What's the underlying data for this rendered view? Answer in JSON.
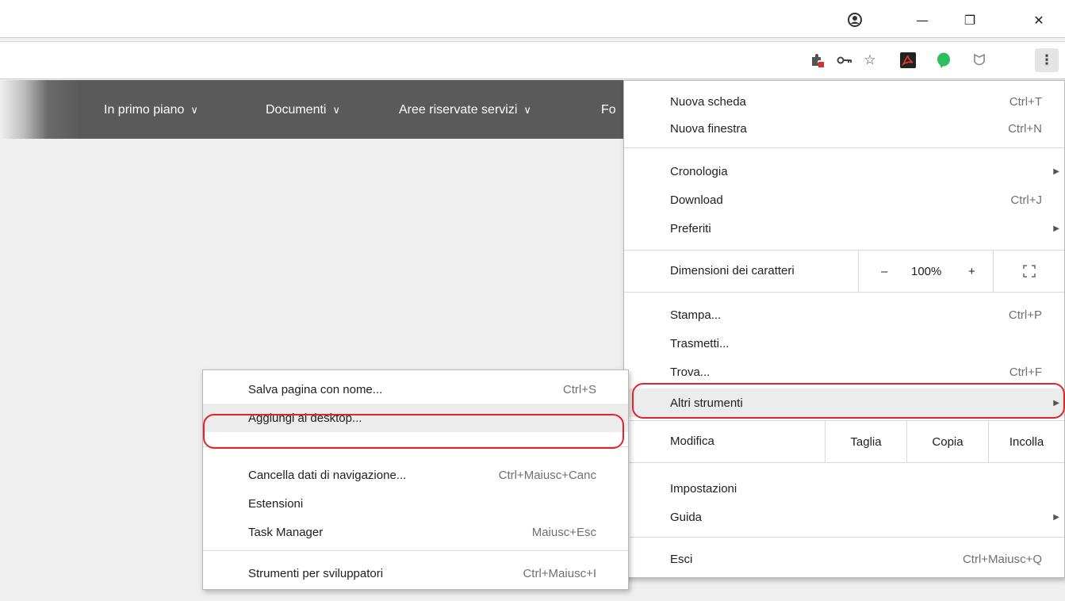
{
  "window": {
    "profile_icon": "account-circle-icon",
    "minimize_glyph": "—",
    "restore_glyph": "❐",
    "close_glyph": "✕"
  },
  "toolbar": {
    "icons": [
      "extension-puzzle-icon",
      "key-icon",
      "star-icon",
      "acrobat-icon",
      "evernote-icon",
      "shield-icon",
      "kebab-menu-icon"
    ]
  },
  "site_nav": {
    "items": [
      {
        "label": "In primo piano"
      },
      {
        "label": "Documenti"
      },
      {
        "label": "Aree riservate servizi"
      },
      {
        "label": "Fo"
      }
    ],
    "chevron": "∨"
  },
  "main_menu": {
    "nuova_scheda": {
      "label": "Nuova scheda",
      "shortcut": "Ctrl+T"
    },
    "nuova_finestra": {
      "label": "Nuova finestra",
      "shortcut": "Ctrl+N"
    },
    "cronologia": {
      "label": "Cronologia"
    },
    "download": {
      "label": "Download",
      "shortcut": "Ctrl+J"
    },
    "preferiti": {
      "label": "Preferiti"
    },
    "zoom": {
      "label": "Dimensioni dei caratteri",
      "minus": "–",
      "value": "100%",
      "plus": "+"
    },
    "stampa": {
      "label": "Stampa...",
      "shortcut": "Ctrl+P"
    },
    "trasmetti": {
      "label": "Trasmetti..."
    },
    "trova": {
      "label": "Trova...",
      "shortcut": "Ctrl+F"
    },
    "altri_strumenti": {
      "label": "Altri strumenti"
    },
    "modifica": {
      "label": "Modifica",
      "taglia": "Taglia",
      "copia": "Copia",
      "incolla": "Incolla"
    },
    "impostazioni": {
      "label": "Impostazioni"
    },
    "guida": {
      "label": "Guida"
    },
    "esci": {
      "label": "Esci",
      "shortcut": "Ctrl+Maiusc+Q"
    }
  },
  "sub_menu": {
    "salva": {
      "label": "Salva pagina con nome...",
      "shortcut": "Ctrl+S"
    },
    "aggiungi": {
      "label": "Aggiungi al desktop..."
    },
    "cancella": {
      "label": "Cancella dati di navigazione...",
      "shortcut": "Ctrl+Maiusc+Canc"
    },
    "estensioni": {
      "label": "Estensioni"
    },
    "task_manager": {
      "label": "Task Manager",
      "shortcut": "Maiusc+Esc"
    },
    "strumenti_sviluppatori": {
      "label": "Strumenti per sviluppatori",
      "shortcut": "Ctrl+Maiusc+I"
    }
  },
  "colors": {
    "highlight_ring": "#e0242d",
    "nav_background": "#5a5a5a",
    "evernote_green": "#2dbe60",
    "acrobat_red": "#b30b00"
  }
}
